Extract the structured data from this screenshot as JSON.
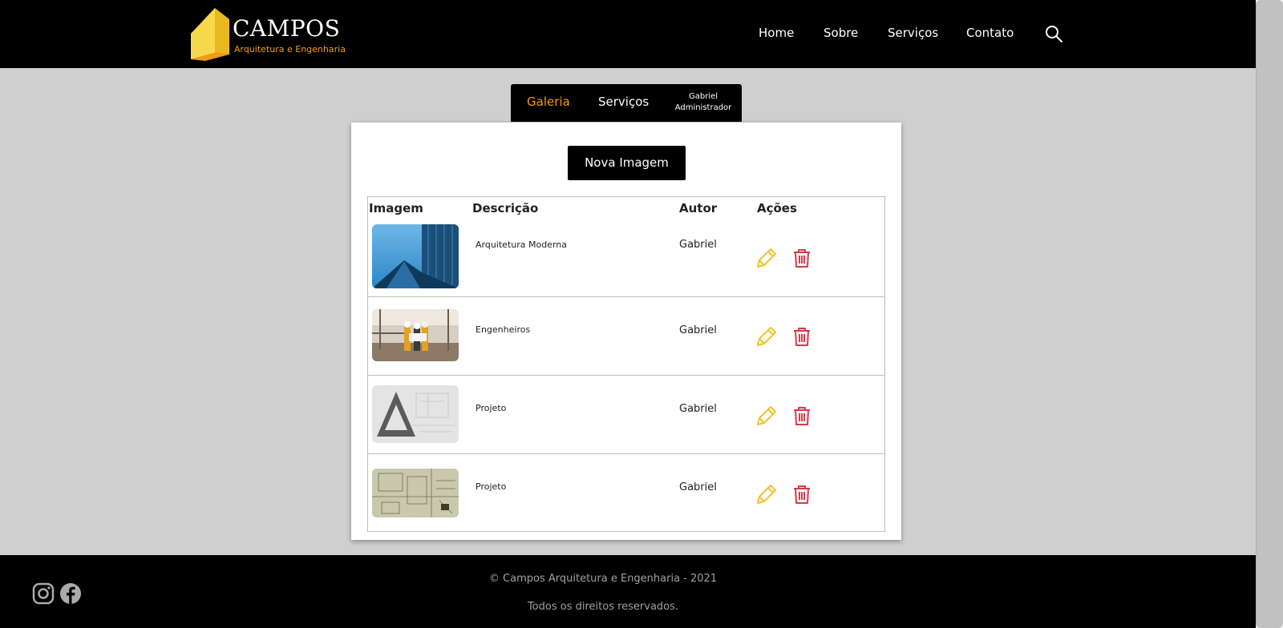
{
  "header": {
    "brand": "CAMPOS",
    "brand_sub": "Arquitetura e Engenharia",
    "nav": [
      "Home",
      "Sobre",
      "Serviços",
      "Contato"
    ],
    "search_icon": "search-icon"
  },
  "tabs": {
    "items": [
      "Galeria",
      "Serviços"
    ],
    "active": "Galeria",
    "user_name": "Gabriel",
    "user_role": "Administrador"
  },
  "gallery": {
    "new_button": "Nova Imagem",
    "columns": [
      "Imagem",
      "Descrição",
      "Autor",
      "Ações"
    ],
    "rows": [
      {
        "description": "Arquitetura Moderna",
        "author": "Gabriel"
      },
      {
        "description": "Engenheiros",
        "author": "Gabriel"
      },
      {
        "description": "Projeto",
        "author": "Gabriel"
      },
      {
        "description": "Projeto",
        "author": "Gabriel"
      }
    ],
    "actions": [
      "pencil-icon",
      "trash-icon"
    ]
  },
  "footer": {
    "copyright": "© Campos Arquitetura e Engenharia - 2021",
    "rights": "Todos os direitos reservados.",
    "social": [
      "instagram-icon",
      "facebook-icon"
    ]
  },
  "colors": {
    "accent": "#f39c12",
    "edit": "#f2c12e",
    "delete": "#d63a4a",
    "header_bg": "#000000",
    "page_bg": "#cfcfcf"
  }
}
